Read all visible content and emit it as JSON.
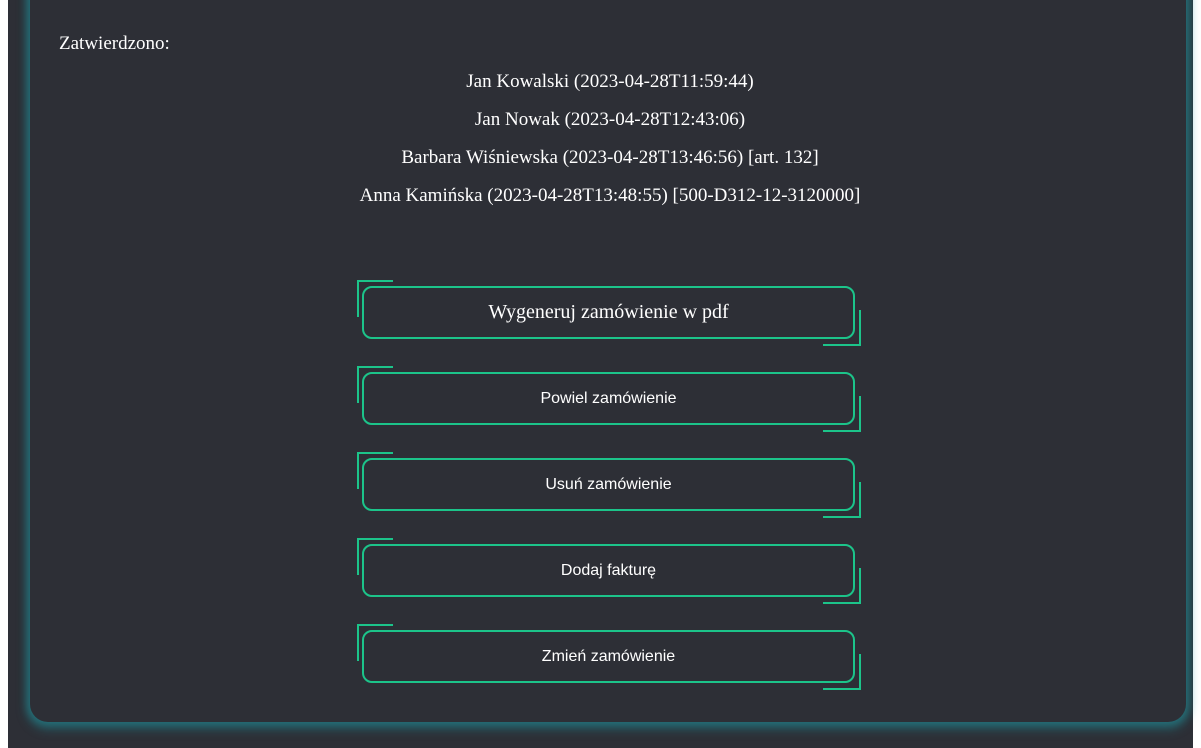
{
  "approvals": {
    "label": "Zatwierdzono:",
    "entries": [
      "Jan Kowalski (2023-04-28T11:59:44)",
      "Jan Nowak (2023-04-28T12:43:06)",
      "Barbara Wiśniewska (2023-04-28T13:46:56) [art. 132]",
      "Anna Kamińska (2023-04-28T13:48:55) [500-D312-12-3120000]"
    ]
  },
  "actions": {
    "generate_pdf": "Wygeneruj zamówienie w pdf",
    "duplicate": "Powiel zamówienie",
    "delete": "Usuń zamówienie",
    "add_invoice": "Dodaj fakturę",
    "edit": "Zmień zamówienie"
  },
  "colors": {
    "background": "#2d2f36",
    "accent": "#1cc48a",
    "glow": "#2096a0",
    "text": "#ffffff"
  }
}
